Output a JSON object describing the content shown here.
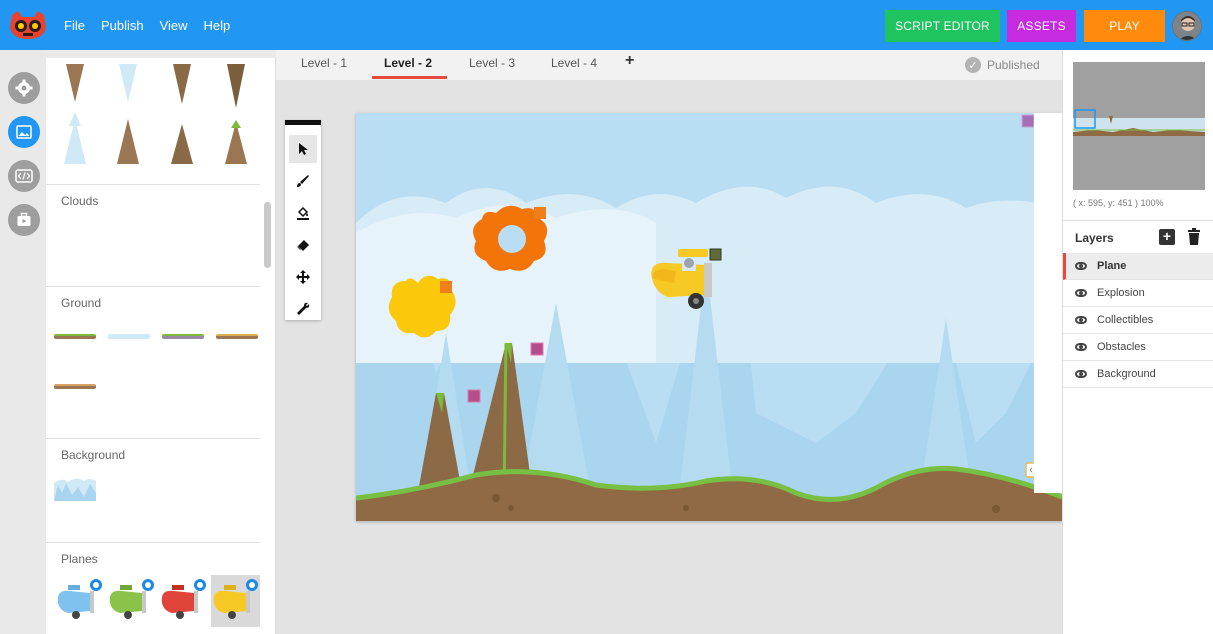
{
  "menu": {
    "items": [
      "File",
      "Publish",
      "View",
      "Help"
    ]
  },
  "toolbar": {
    "script_editor_label": "SCRIPT EDITOR",
    "assets_label": "ASSETS",
    "play_label": "PLAY"
  },
  "tabs": {
    "items": [
      {
        "label": "Level - 1",
        "active": false
      },
      {
        "label": "Level - 2",
        "active": true
      },
      {
        "label": "Level - 3",
        "active": false
      },
      {
        "label": "Level - 4",
        "active": false
      }
    ],
    "add_label": "+",
    "status": "Published"
  },
  "rail": {
    "icons": [
      "gear-icon",
      "image-icon",
      "code-icon",
      "briefcase-icon"
    ]
  },
  "assets": {
    "sections": [
      {
        "label": "Clouds"
      },
      {
        "label": "Ground"
      },
      {
        "label": "Background"
      },
      {
        "label": "Planes"
      }
    ]
  },
  "tools": [
    "pointer-icon",
    "brush-icon",
    "fill-icon",
    "eraser-icon",
    "move-icon",
    "wrench-icon"
  ],
  "minimap": {
    "coords": "( x: 595, y: 451 ) 100%"
  },
  "layers": {
    "title": "Layers",
    "items": [
      {
        "label": "Plane",
        "active": true
      },
      {
        "label": "Explosion",
        "active": false
      },
      {
        "label": "Collectibles",
        "active": false
      },
      {
        "label": "Obstacles",
        "active": false
      },
      {
        "label": "Background",
        "active": false
      }
    ]
  },
  "colors": {
    "topbar": "#2196f3",
    "script_editor": "#1fc45f",
    "assets": "#c62be0",
    "play": "#ff8a0c",
    "active_tab": "#e64a3f"
  }
}
